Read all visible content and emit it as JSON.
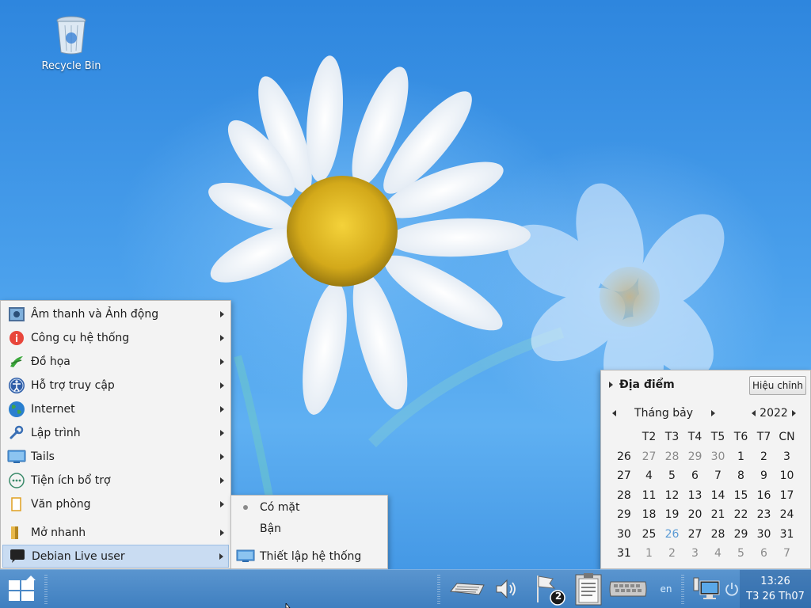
{
  "desktop": {
    "recycle_bin_label": "Recycle Bin"
  },
  "app_menu": {
    "items": [
      {
        "label": "Âm thanh và Ảnh động",
        "icon": "multimedia-icon"
      },
      {
        "label": "Công cụ hệ thống",
        "icon": "system-info-icon"
      },
      {
        "label": "Đồ họa",
        "icon": "graphics-icon"
      },
      {
        "label": "Hỗ trợ truy cập",
        "icon": "accessibility-icon"
      },
      {
        "label": "Internet",
        "icon": "globe-icon"
      },
      {
        "label": "Lập trình",
        "icon": "wrench-icon"
      },
      {
        "label": "Tails",
        "icon": "tails-icon"
      },
      {
        "label": "Tiện ích bổ trợ",
        "icon": "ellipsis-icon"
      },
      {
        "label": "Văn phòng",
        "icon": "document-icon"
      },
      {
        "label": "Mở nhanh",
        "icon": "folder-icon"
      },
      {
        "label": "Debian Live user",
        "icon": "chat-bubble-icon"
      }
    ]
  },
  "sub_menu": {
    "items": [
      {
        "label": "Có mặt"
      },
      {
        "label": "Bận"
      },
      {
        "label": "Thiết lập hệ thống"
      }
    ]
  },
  "calendar": {
    "title": "Địa điểm",
    "edit_label": "Hiệu chỉnh",
    "month": "Tháng bảy",
    "year": "2022",
    "weekdays": [
      "T2",
      "T3",
      "T4",
      "T5",
      "T6",
      "T7",
      "CN"
    ],
    "weeks": [
      {
        "week": "26",
        "days": [
          "27",
          "28",
          "29",
          "30",
          "1",
          "2",
          "3"
        ]
      },
      {
        "week": "27",
        "days": [
          "4",
          "5",
          "6",
          "7",
          "8",
          "9",
          "10"
        ]
      },
      {
        "week": "28",
        "days": [
          "11",
          "12",
          "13",
          "14",
          "15",
          "16",
          "17"
        ]
      },
      {
        "week": "29",
        "days": [
          "18",
          "19",
          "20",
          "21",
          "22",
          "23",
          "24"
        ]
      },
      {
        "week": "30",
        "days": [
          "25",
          "26",
          "27",
          "28",
          "29",
          "30",
          "31"
        ]
      },
      {
        "week": "31",
        "days": [
          "1",
          "2",
          "3",
          "4",
          "5",
          "6",
          "7"
        ]
      }
    ],
    "today": "26"
  },
  "taskbar": {
    "language": "en",
    "notification_count": "2",
    "clock_time": "13:26",
    "clock_date": "T3 26 Th07"
  },
  "colors": {
    "taskbar": "#4a88c8",
    "menu_bg": "#f3f3f3",
    "active_item": "#c9dcf2",
    "today": "#5b9bd5"
  }
}
